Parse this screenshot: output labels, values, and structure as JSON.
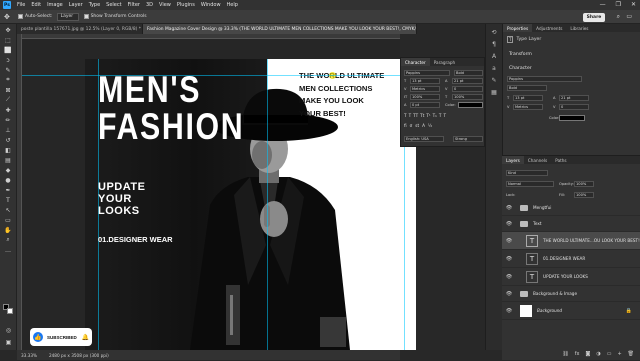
{
  "app": {
    "logo": "Ps"
  },
  "menu": [
    "File",
    "Edit",
    "Image",
    "Layer",
    "Type",
    "Select",
    "Filter",
    "3D",
    "View",
    "Plugins",
    "Window",
    "Help"
  ],
  "window_controls": [
    "—",
    "❐",
    "✕"
  ],
  "options_bar": {
    "auto_select_label": "Auto-Select:",
    "auto_select_value": "Layer",
    "transform_label": "Show Transform Controls",
    "share_label": "Share"
  },
  "doc_tabs": [
    {
      "label": "poste plantilla 157671.jpg @ 12.5% (Layer 0, RGB/8) *",
      "active": false
    },
    {
      "label": "Fashion Magazine Cover Design @ 33.3% (THE WORLD ULTIMATE MEN COLLECTIONS MAKE YOU LOOK YOUR BEST!, CMYK/8) *",
      "active": true
    }
  ],
  "canvas": {
    "headline_line1": "MEN'S",
    "headline_line2": "FASHION",
    "sub_line1": "UPDATE",
    "sub_line2": "YOUR",
    "sub_line3": "LOOKS",
    "designer": "01.DESIGNER WEAR",
    "promo_line1": "THE WORLD ULTIMATE",
    "promo_line2": "MEN COLLECTIONS",
    "promo_line3": "MAKE YOU LOOK",
    "promo_line4": "YOUR BEST!"
  },
  "subscribe": {
    "label": "SUBSCRIBED",
    "bell": "🔔"
  },
  "status_bar": {
    "zoom": "33.33%",
    "doc_size": "2480 px x 3508 px (300 ppi)"
  },
  "character_panel": {
    "tabs": [
      "Character",
      "Paragraph"
    ],
    "font": "Poppins",
    "style": "Bold",
    "size": "13 pt",
    "leading": "21 pt",
    "kerning": "Metrics",
    "tracking": "0",
    "vscale": "100%",
    "hscale": "100%",
    "baseline": "0 pt",
    "color_label": "Color:",
    "language": "English: USA",
    "aa": "Strong"
  },
  "properties_panel": {
    "tabs": [
      "Properties",
      "Adjustments",
      "Libraries"
    ],
    "kind": "Type Layer",
    "transform": "Transform",
    "character": "Character",
    "font": "Poppins",
    "style": "Bold",
    "size": "13 pt",
    "leading": "21 pt",
    "kerning": "Metrics",
    "tracking": "0",
    "color_label": "Color:"
  },
  "layers_panel": {
    "tabs": [
      "Layers",
      "Channels",
      "Paths"
    ],
    "kind_filter": "Kind",
    "blend": "Normal",
    "opacity_label": "Opacity:",
    "opacity": "100%",
    "lock_label": "Lock:",
    "fill_label": "Fill:",
    "fill": "100%",
    "layers": [
      {
        "name": "Mengtfui",
        "type": "group"
      },
      {
        "name": "Text",
        "type": "group"
      },
      {
        "name": "THE WORLD ULTIMATE...OU LOOK YOUR BEST!",
        "type": "text",
        "selected": true
      },
      {
        "name": "01.DESIGNER WEAR",
        "type": "text"
      },
      {
        "name": "UPDATE YOUR LOOKS",
        "type": "text"
      },
      {
        "name": "Background & Image",
        "type": "group"
      },
      {
        "name": "Background",
        "type": "bg"
      }
    ]
  },
  "colors": {
    "accent": "#31a8ff",
    "selected_layer": "#4a4a4a",
    "canvas_white": "#ffffff"
  }
}
